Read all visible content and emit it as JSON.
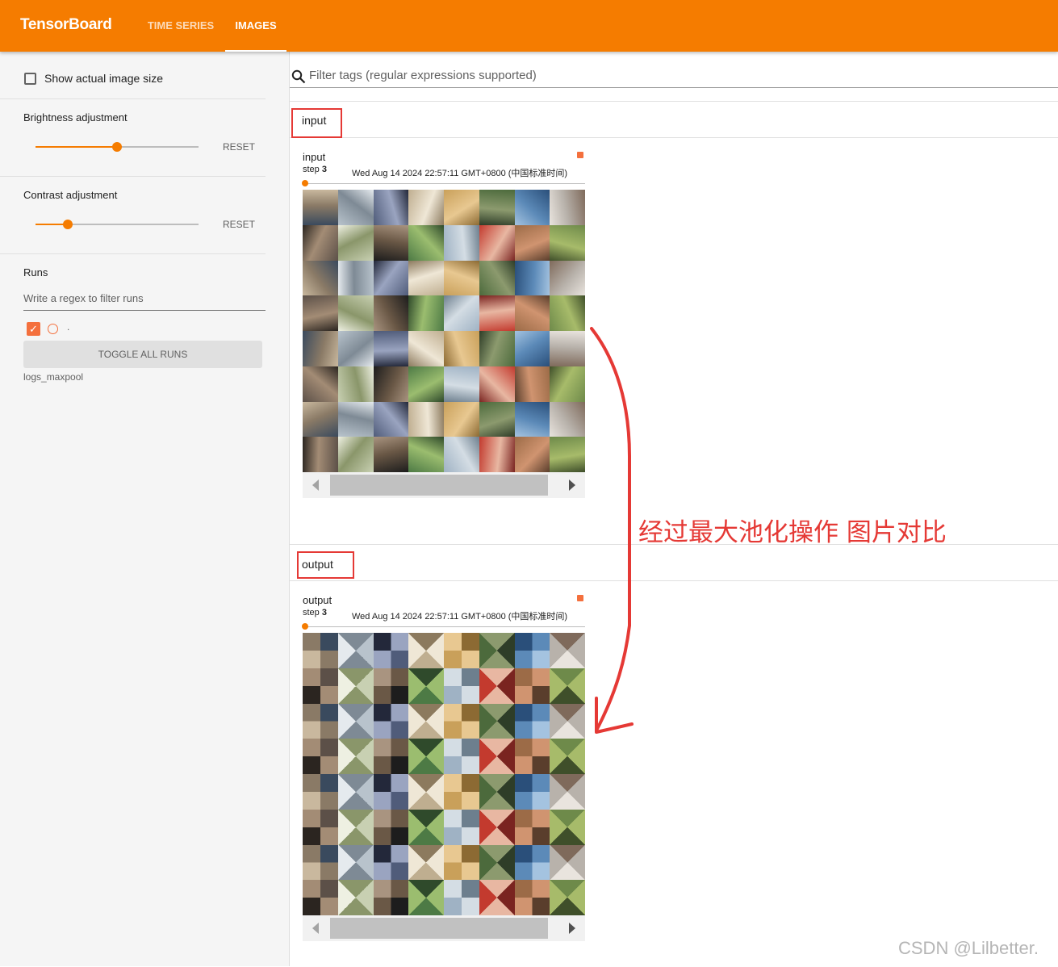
{
  "header": {
    "brand": "TensorBoard",
    "tabs": [
      {
        "label": "TIME SERIES"
      },
      {
        "label": "IMAGES"
      }
    ],
    "active_tab": "IMAGES"
  },
  "sidebar": {
    "actual_size_label": "Show actual image size",
    "actual_size_checked": false,
    "brightness": {
      "label": "Brightness adjustment",
      "reset_label": "RESET",
      "level": 0.5
    },
    "contrast": {
      "label": "Contrast adjustment",
      "reset_label": "RESET",
      "level": 0.2
    },
    "runs": {
      "title": "Runs",
      "filter_placeholder": "Write a regex to filter runs",
      "run_label": ".",
      "run_checked": true,
      "toggle_label": "TOGGLE ALL RUNS",
      "run_name": "logs_maxpool"
    }
  },
  "main": {
    "filter_placeholder": "Filter tags (regular expressions supported)",
    "groups": [
      {
        "title": "input",
        "card_title": "input",
        "step_label": "step",
        "step_value": "3",
        "timestamp": "Wed Aug 14 2024 22:57:11 GMT+0800 (中国标准时间)",
        "pixelated": false
      },
      {
        "title": "output",
        "card_title": "output",
        "step_label": "step",
        "step_value": "3",
        "timestamp": "Wed Aug 14 2024 22:57:11 GMT+0800 (中国标准时间)",
        "pixelated": true
      }
    ]
  },
  "annotation": {
    "text": "经过最大池化操作 图片对比"
  },
  "watermark": "CSDN @Lilbetter.",
  "colors": {
    "accent": "#f57c00",
    "run": "#f4703d",
    "annotation": "#e53935"
  }
}
